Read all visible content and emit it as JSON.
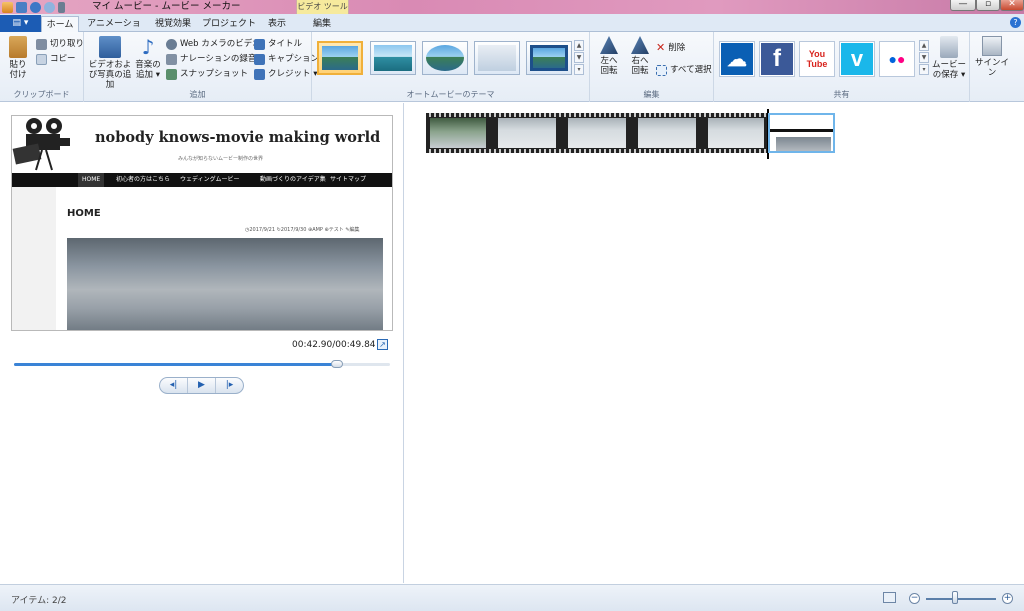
{
  "window": {
    "title": "マイ ムービー - ムービー メーカー",
    "context_tab_group": "ビデオ ツール",
    "minimize": "—",
    "maximize": "▫",
    "close": "✕"
  },
  "tabs": {
    "file_glyph": "▤ ▾",
    "items": [
      "ホーム",
      "アニメーション",
      "視覚効果",
      "プロジェクト",
      "表示",
      "編集"
    ],
    "active": "ホーム",
    "help": "?"
  },
  "ribbon": {
    "clipboard": {
      "label": "クリップボード",
      "paste": "貼り付け",
      "cut": "切り取り",
      "copy": "コピー"
    },
    "add": {
      "label": "追加",
      "add_videos_photos": "ビデオおよび写真の追加",
      "add_music": "音楽の追加 ▾",
      "webcam_video": "Web カメラのビデオ",
      "record_narration": "ナレーションの録音 ▾",
      "snapshot": "スナップショット",
      "title": "タイトル",
      "caption": "キャプション",
      "credits": "クレジット ▾"
    },
    "automovie": {
      "label": "オートムービーのテーマ",
      "themes": [
        "theme-1",
        "theme-2",
        "theme-3",
        "theme-4",
        "theme-5"
      ],
      "selected_index": 0
    },
    "editing": {
      "label": "編集",
      "rotate_left": "左へ回転",
      "rotate_right": "右へ回転",
      "delete": "削除",
      "select_all": "すべて選択"
    },
    "share": {
      "label": "共有",
      "services": [
        {
          "name": "OneDrive",
          "glyph": "☁",
          "color": "#0a5fb4"
        },
        {
          "name": "Facebook",
          "glyph": "f",
          "color": "#3b5998"
        },
        {
          "name": "YouTube",
          "glyph": "You Tube",
          "color": "#d8241e"
        },
        {
          "name": "Vimeo",
          "glyph": "v",
          "color": "#1ab7ea"
        },
        {
          "name": "Flickr",
          "glyph": "●●",
          "color": "#ffffff"
        }
      ],
      "save_movie": "ムービーの保存 ▾",
      "sign_in": "サインイン"
    }
  },
  "preview": {
    "site_title": "nobody knows-movie making world",
    "site_subtitle": "みんなが知らないムービー制作の世界",
    "nav": [
      "HOME",
      "初心者の方はこちら",
      "ウェディングムービー",
      "動画づくりのアイデア集",
      "サイトマップ"
    ],
    "page_heading": "HOME",
    "meta": "◷2017/9/21  ↻2017/9/30  ⊕AMP ⊕テスト ✎編集",
    "time": "00:42.90/00:49.84",
    "progress": 0.86,
    "controls": {
      "prev": "◂|",
      "play": "▶",
      "next": "|▸"
    },
    "fullscreen": "↗"
  },
  "storyboard": {
    "clips": [
      {
        "name": "video-clip",
        "frames": 5
      },
      {
        "name": "web-capture-clip"
      }
    ]
  },
  "status": {
    "items": "アイテム: 2/2",
    "zoom_minus": "−",
    "zoom_plus": "+",
    "zoom_level": 0.42
  },
  "colors": {
    "accent": "#3a83d6",
    "file_tab": "#1c5cb4",
    "selected_theme": "#f0b03a"
  }
}
